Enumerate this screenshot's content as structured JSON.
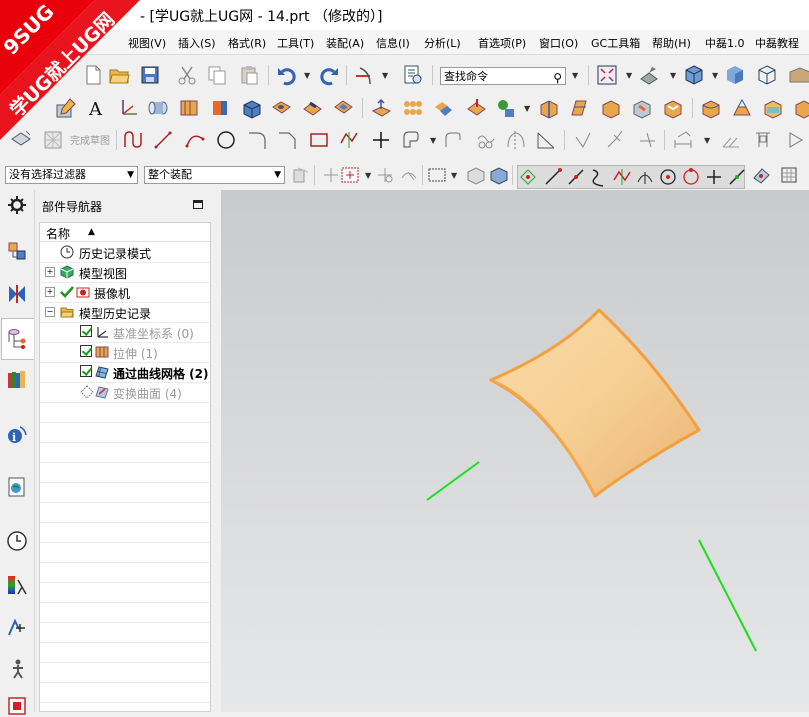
{
  "window": {
    "title": "- [学UG就上UG网 - 14.prt （修改的）]"
  },
  "watermark": {
    "line1": "9SUG",
    "line2": "学UG就上UG网"
  },
  "menubar": {
    "items": [
      "视图(V)",
      "插入(S)",
      "格式(R)",
      "工具(T)",
      "装配(A)",
      "信息(I)",
      "分析(L)",
      "首选项(P)",
      "窗口(O)",
      "GC工具箱",
      "帮助(H)",
      "中磊1.0",
      "中磊教程"
    ]
  },
  "toolbar": {
    "search_placeholder": "查找命令",
    "sketch_finish_label": "完成草图",
    "filter_select": "没有选择过滤器",
    "scope_select": "整个装配"
  },
  "navigator": {
    "title": "部件导航器",
    "column_name": "名称",
    "items": [
      {
        "label": "历史记录模式"
      },
      {
        "label": "模型视图"
      },
      {
        "label": "摄像机"
      },
      {
        "label": "模型历史记录"
      },
      {
        "label": "基准坐标系 (0)"
      },
      {
        "label": "拉伸 (1)"
      },
      {
        "label": "通过曲线网格 (2)"
      },
      {
        "label": "变换曲面 (4)"
      }
    ]
  },
  "colors": {
    "surface_fill": "#f7cf94",
    "surface_edge": "#f2a03d",
    "axis_line": "#19e019",
    "watermark_red": "#e8000b"
  }
}
